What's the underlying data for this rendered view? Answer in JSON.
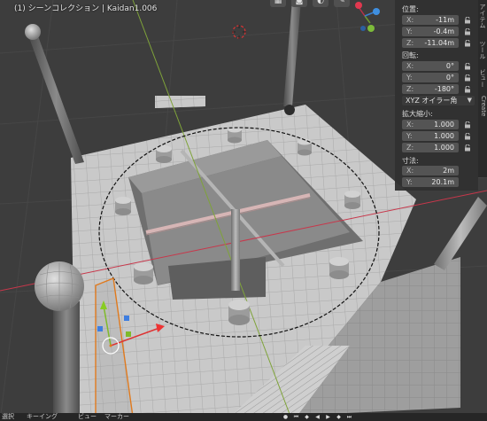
{
  "viewport": {
    "title": "(1) シーンコレクション | Kaidan1.006"
  },
  "top_tools": [
    {
      "name": "grid-tool-icon",
      "glyph": "▦"
    },
    {
      "name": "camera-tool-icon",
      "glyph": "◙"
    },
    {
      "name": "shading-tool-icon",
      "glyph": "◐"
    },
    {
      "name": "wrench-tool-icon",
      "glyph": "✎"
    }
  ],
  "nav_gizmo": {
    "colors": {
      "x": "#e0384f",
      "y": "#7dbb3a",
      "z": "#3f8fe0"
    }
  },
  "transform": {
    "location": {
      "label": "位置:",
      "fields": [
        {
          "axis": "X:",
          "value": "-11m"
        },
        {
          "axis": "Y:",
          "value": "-0.4m"
        },
        {
          "axis": "Z:",
          "value": "-11.04m"
        }
      ]
    },
    "rotation": {
      "label": "回転:",
      "fields": [
        {
          "axis": "X:",
          "value": "0°"
        },
        {
          "axis": "Y:",
          "value": "0°"
        },
        {
          "axis": "Z:",
          "value": "-180°"
        }
      ],
      "mode": "XYZ オイラー角"
    },
    "scale": {
      "label": "拡大縮小:",
      "fields": [
        {
          "axis": "X:",
          "value": "1.000"
        },
        {
          "axis": "Y:",
          "value": "1.000"
        },
        {
          "axis": "Z:",
          "value": "1.000"
        }
      ]
    },
    "dimensions": {
      "label": "寸法:",
      "fields": [
        {
          "axis": "X:",
          "value": "2m"
        },
        {
          "axis": "Y:",
          "value": "20.1m"
        },
        {
          "axis": "Z:",
          "value": "11.4m"
        }
      ]
    }
  },
  "side_tabs": [
    "アイテム",
    "ツール",
    "ビュー",
    "Create"
  ],
  "bottom_bar": {
    "menu": [
      "選択",
      "キーイング",
      "ビュー",
      "マーカー"
    ]
  },
  "colors": {
    "panel_bg": "#303030",
    "field_bg": "#545454",
    "accent_orange": "#e07a1e",
    "axis_red": "#c8374b",
    "axis_green": "#7fa33a"
  }
}
